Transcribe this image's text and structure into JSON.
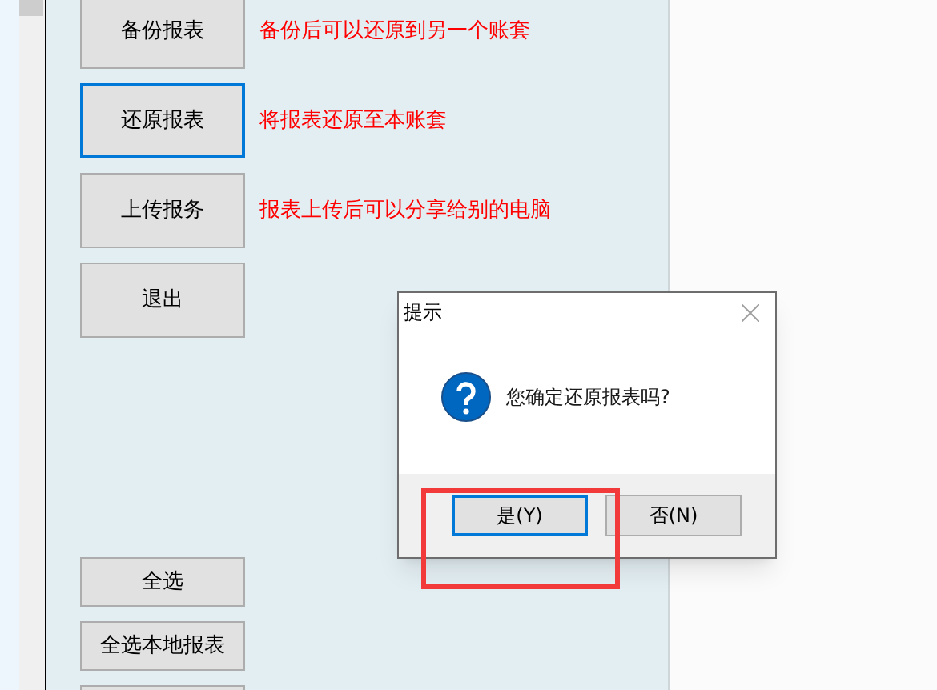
{
  "actions": [
    {
      "label": "备份报表",
      "description": "备份后可以还原到另一个账套",
      "focused": false
    },
    {
      "label": "还原报表",
      "description": "将报表还原至本账套",
      "focused": true
    },
    {
      "label": "上传报务",
      "description": "报表上传后可以分享给别的电脑",
      "focused": false
    },
    {
      "label": "退出",
      "focused": false
    }
  ],
  "bottom_buttons": [
    {
      "label": "全选"
    },
    {
      "label": "全选本地报表"
    }
  ],
  "dialog": {
    "title": "提示",
    "message": "您确定还原报表吗?",
    "buttons": [
      {
        "label": "是(Y)",
        "selected": true
      },
      {
        "label": "否(N)",
        "selected": false
      }
    ]
  },
  "highlight_box": true
}
